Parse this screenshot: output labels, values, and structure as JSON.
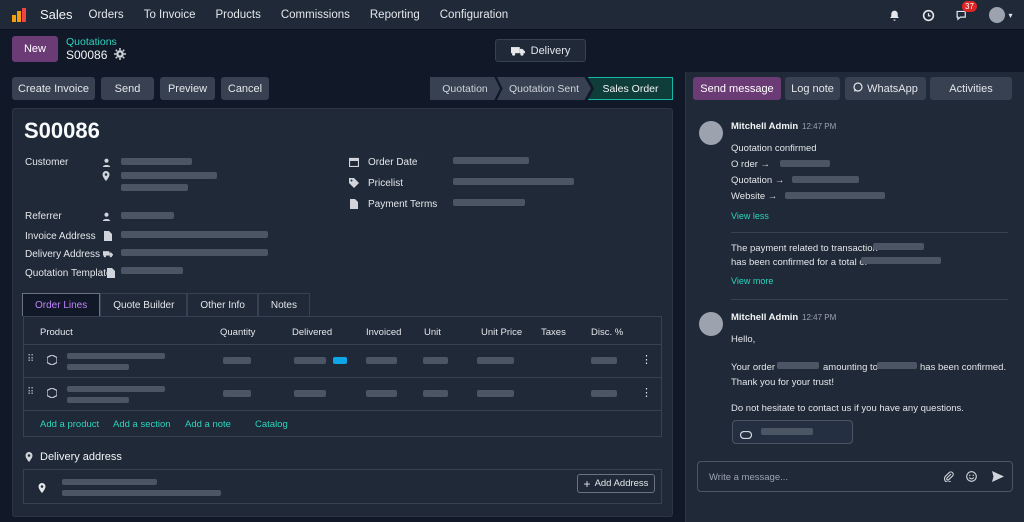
{
  "app": {
    "name": "Sales"
  },
  "menu": [
    "Orders",
    "To Invoice",
    "Products",
    "Commissions",
    "Reporting",
    "Configuration"
  ],
  "topbar": {
    "messages_badge": "37"
  },
  "control": {
    "new_label": "New",
    "breadcrumb_parent": "Quotations",
    "record_name": "S00086",
    "delivery_label": "Delivery"
  },
  "actions": [
    "Create Invoice",
    "Send",
    "Preview",
    "Cancel"
  ],
  "stages": [
    "Quotation",
    "Quotation Sent",
    "Sales Order"
  ],
  "active_stage": "Sales Order",
  "form": {
    "title": "S00086",
    "labels": {
      "customer": "Customer",
      "referrer": "Referrer",
      "invoice_address": "Invoice Address",
      "delivery_address": "Delivery Address",
      "quotation_template": "Quotation Template",
      "order_date": "Order Date",
      "pricelist": "Pricelist",
      "payment_terms": "Payment Terms"
    }
  },
  "tabs": [
    "Order Lines",
    "Quote Builder",
    "Other Info",
    "Notes"
  ],
  "table": {
    "headers": [
      "Product",
      "Quantity",
      "Delivered",
      "Invoiced",
      "Unit",
      "Unit Price",
      "Taxes",
      "Disc. %"
    ],
    "add_links": [
      "Add a product",
      "Add a section",
      "Add a note",
      "Catalog"
    ]
  },
  "delivery_section": {
    "title": "Delivery address",
    "add_button": "Add Address"
  },
  "chatter": {
    "buttons": [
      "Send message",
      "Log note",
      "WhatsApp",
      "Activities"
    ],
    "message1": {
      "author": "Mitchell Admin",
      "time": "12:47 PM",
      "heading": "Quotation confirmed",
      "lines": [
        "O rder →",
        "Quotation →",
        "Website →"
      ],
      "view_less": "View less",
      "payment_line1": "The payment related to transaction",
      "payment_line2": "has been confirmed for a total of",
      "view_more": "View more"
    },
    "message2": {
      "author": "Mitchell Admin",
      "time": "12:47 PM",
      "hello": "Hello,",
      "order_part1": "Your order",
      "order_part2": "amounting to",
      "order_part3": "has been confirmed.",
      "thanks": "Thank you for your trust!",
      "questions": "Do not hesitate to contact us if you have any questions."
    },
    "composer_placeholder": "Write a message..."
  },
  "colors": {
    "accent": "#6b3b76",
    "link": "#2dd4bf",
    "active_stage": "#14b8a6",
    "badge": "#dc2626"
  }
}
